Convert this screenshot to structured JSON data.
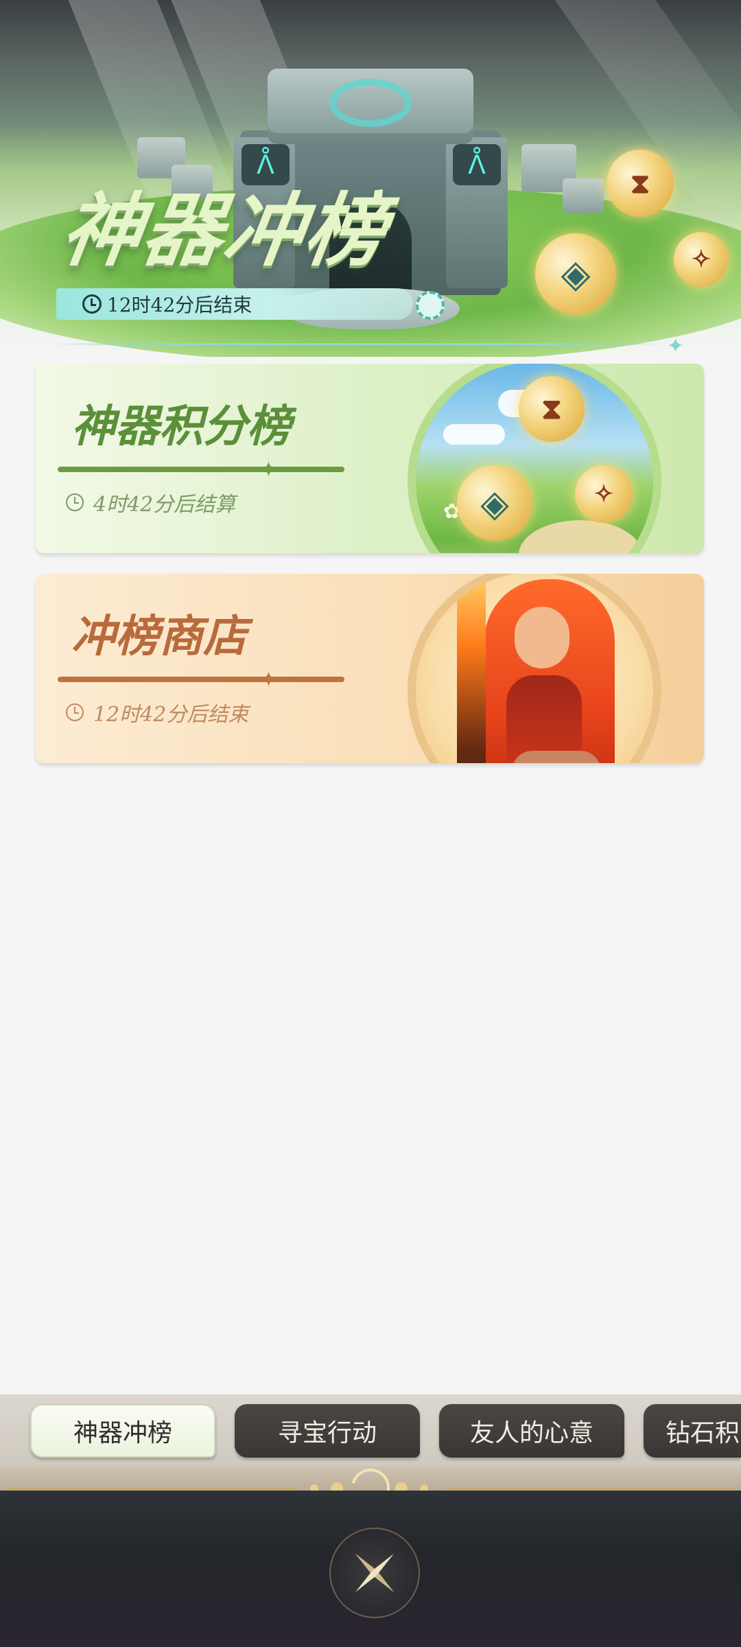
{
  "header": {
    "title": "神器冲榜",
    "countdown": "12时42分后结束"
  },
  "cards": [
    {
      "title": "神器积分榜",
      "time": "4时42分后结算"
    },
    {
      "title": "冲榜商店",
      "time": "12时42分后结束"
    }
  ],
  "tabs": [
    {
      "label": "神器冲榜",
      "active": true
    },
    {
      "label": "寻宝行动",
      "active": false
    },
    {
      "label": "友人的心意",
      "active": false
    },
    {
      "label": "钻石积",
      "active": false
    }
  ],
  "colors": {
    "green_accent": "#5b8f3a",
    "orange_accent": "#b86a3c",
    "teal_accent": "#9ae6dd",
    "tab_dark": "#3a3633"
  },
  "icons": [
    "clock-icon",
    "gear-icon",
    "sparkle-icon",
    "moon-icon",
    "close-icon"
  ]
}
